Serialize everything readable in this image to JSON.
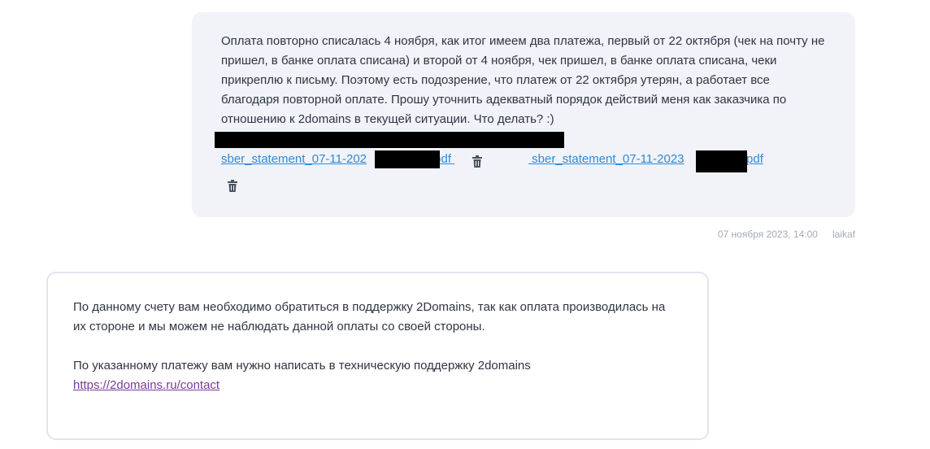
{
  "user_message": {
    "text": "Оплата повторно списалась 4 ноября, как итог имеем два платежа, первый от 22 октября (чек на почту не пришел, в банке оплата списана) и второй от 4 ноября, чек пришел, в банке оплата списана, чеки прикреплю к письму. Поэтому есть подозрение, что платеж от 22 октября утерян, а работает все благодаря повторной оплате. Прошу уточнить адекватный порядок действий меня как заказчика по отношению к 2domains в текущей ситуации. Что делать? :)",
    "attachments": [
      {
        "prefix": "sber_statement_07-11-202",
        "suffix": ".pdf "
      },
      {
        "prefix": " sber_statement_07-11-2023",
        "suffix": "3.pdf"
      }
    ],
    "timestamp": "07 ноября 2023, 14:00",
    "author": "laikaf"
  },
  "support_reply": {
    "paragraph1": "По данному счету вам необходимо обратиться в поддержку 2Domains, так как оплата производилась на их стороне и мы можем не наблюдать данной оплаты со своей стороны.",
    "paragraph2": "По указанному платежу вам нужно написать в техническую поддержку 2domains",
    "link": "https://2domains.ru/contact"
  },
  "icons": {
    "delete": "trash-icon"
  },
  "colors": {
    "user_bubble_bg": "#f1f3f8",
    "link_blue": "#2f8ad9",
    "link_purple": "#7b3a9a",
    "meta_gray": "#a3aab6"
  }
}
